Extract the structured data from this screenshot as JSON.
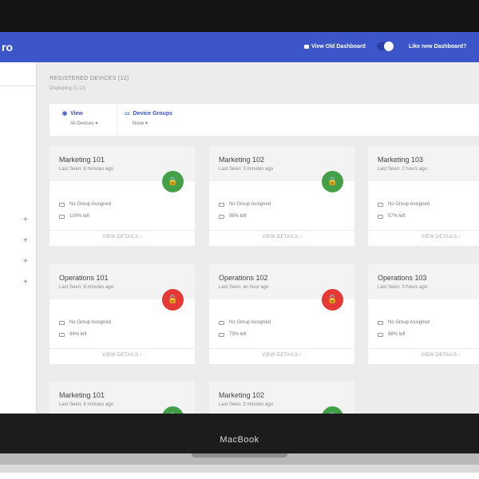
{
  "app": {
    "brand": "ro",
    "view_old_dashboard": "View Old Dashboard",
    "like_new_dashboard": "Like new Dashboard?",
    "toggle_on": true
  },
  "page": {
    "heading": "REGISTERED DEVICES (12)",
    "subheading": "Displaying (1-12)"
  },
  "filters": {
    "view_label": "View",
    "view_value": "All Devices",
    "group_label": "Device Groups",
    "group_value": "None"
  },
  "sidebar": {
    "plus_icon": "+"
  },
  "cards": [
    {
      "title": "Marketing 101",
      "last_seen": "Last Seen: 8 minutes ago",
      "status": "locked",
      "color": "#43a047",
      "group": "No Group Assigned",
      "battery": "100% left",
      "details": "VIEW DETAILS"
    },
    {
      "title": "Marketing 102",
      "last_seen": "Last Seen: 3 minutes ago",
      "status": "locked",
      "color": "#43a047",
      "group": "No Group Assigned",
      "battery": "98% left",
      "details": "VIEW DETAILS"
    },
    {
      "title": "Marketing 103",
      "last_seen": "Last Seen: 2 hours ago",
      "status": "locked",
      "color": "#43a047",
      "group": "No Group Assigned",
      "battery": "57% left",
      "details": "VIEW DETAILS"
    },
    {
      "title": "Operations 101",
      "last_seen": "Last Seen: 8 minutes ago",
      "status": "unlocked",
      "color": "#e53935",
      "group": "No Group Assigned",
      "battery": "94% left",
      "details": "VIEW DETAILS"
    },
    {
      "title": "Operations 102",
      "last_seen": "Last Seen: an hour ago",
      "status": "unlocked",
      "color": "#e53935",
      "group": "No Group Assigned",
      "battery": "73% left",
      "details": "VIEW DETAILS"
    },
    {
      "title": "Operations 103",
      "last_seen": "Last Seen: 3 hours ago",
      "status": "locked",
      "color": "#43a047",
      "group": "No Group Assigned",
      "battery": "98% left",
      "details": "VIEW DETAILS"
    },
    {
      "title": "Marketing 101",
      "last_seen": "Last Seen: 8 minutes ago",
      "status": "locked",
      "color": "#43a047",
      "group": "",
      "battery": "",
      "details": ""
    },
    {
      "title": "Marketing 102",
      "last_seen": "Last Seen: 3 minutes ago",
      "status": "locked",
      "color": "#43a047",
      "group": "",
      "battery": "",
      "details": ""
    }
  ],
  "device": {
    "label": "MacBook"
  },
  "colors": {
    "appbar": "#3c55c8",
    "success": "#43a047",
    "danger": "#e53935",
    "background": "#ececec"
  }
}
